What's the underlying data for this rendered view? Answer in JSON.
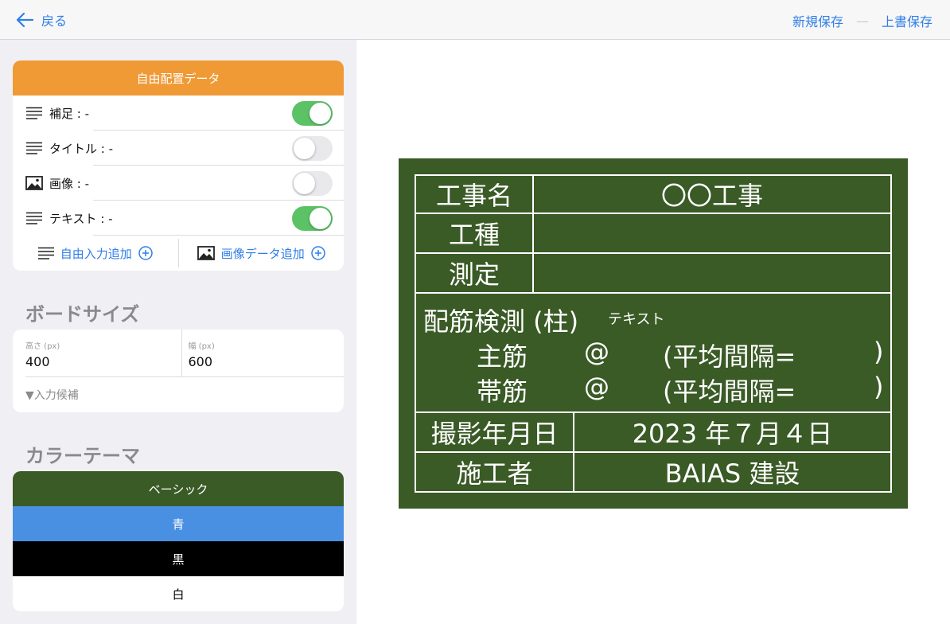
{
  "nav": {
    "back_label": "戻る",
    "save_new": "新規保存",
    "separator": "—",
    "overwrite": "上書保存"
  },
  "free_data": {
    "header": "自由配置データ",
    "rows": [
      {
        "label": "補足 : -",
        "icon": "text-lines-icon",
        "on": true
      },
      {
        "label": "タイトル : -",
        "icon": "text-lines-icon",
        "on": false
      },
      {
        "label": "画像 : -",
        "icon": "image-icon",
        "on": false
      },
      {
        "label": "テキスト : -",
        "icon": "text-lines-icon",
        "on": true
      }
    ],
    "add_free_input": "自由入力追加",
    "add_image_data": "画像データ追加"
  },
  "board_size": {
    "title": "ボードサイズ",
    "height_caption": "高さ (px)",
    "height_value": "400",
    "width_caption": "幅 (px)",
    "width_value": "600",
    "suggest": "▼入力候補"
  },
  "color_theme": {
    "title": "カラーテーマ",
    "options": [
      {
        "label": "ベーシック",
        "bg": "#3a5a26",
        "fg": "#ffffff"
      },
      {
        "label": "青",
        "bg": "#4a90e2",
        "fg": "#ffffff"
      },
      {
        "label": "黒",
        "bg": "#000000",
        "fg": "#ffffff"
      },
      {
        "label": "白",
        "bg": "#ffffff",
        "fg": "#000000"
      }
    ]
  },
  "board": {
    "bg": "#3a5a26",
    "project_label": "工事名",
    "project_value": "〇〇工事",
    "type_label": "工種",
    "measure_label": "測定",
    "rebar_title": "配筋検測 (柱)",
    "rebar_text": "テキスト",
    "main_bar": "主筋",
    "hoop_bar": "帯筋",
    "at": "@",
    "avg_label": "(平均間隔=",
    "close_paren": ")",
    "date_label": "撮影年月日",
    "date_value": "2023 年７月４日",
    "builder_label": "施工者",
    "builder_value": "BAIAS 建設"
  }
}
